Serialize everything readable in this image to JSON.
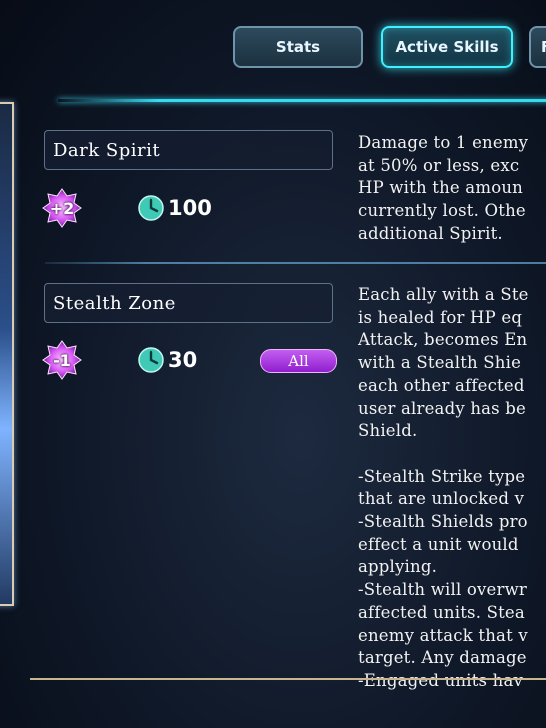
{
  "tabs": {
    "stats": "Stats",
    "active_skills": "Active Skills",
    "next_partial": "F"
  },
  "skills": [
    {
      "name": "Dark Spirit",
      "spirit_cost": "+2",
      "cooldown": "100",
      "target": "",
      "description": "Damage to 1 enemy\nat 50% or less, exc\nHP with the amoun\ncurrently lost. Othe\nadditional Spirit."
    },
    {
      "name": "Stealth Zone",
      "spirit_cost": "-1",
      "cooldown": "30",
      "target": "All",
      "description": "Each ally with a Ste\nis healed for HP eq\nAttack, becomes En\nwith a Stealth Shie\neach other affected\nuser already has be\nShield.\n\n-Stealth Strike type\nthat are unlocked v\n-Stealth Shields pro\neffect a unit would\napplying.\n-Stealth will overwr\naffected units. Stea\nenemy attack that v\ntarget. Any damage\n-Engaged units hav"
    }
  ],
  "icons": {
    "spirit": "spirit-gem-icon",
    "cooldown": "clock-icon"
  },
  "colors": {
    "accent_cyan": "#3ff0ff",
    "target_pill": "#b044e8",
    "spirit_gem": "#d95cf5",
    "cooldown_teal": "#3fc9b6"
  }
}
